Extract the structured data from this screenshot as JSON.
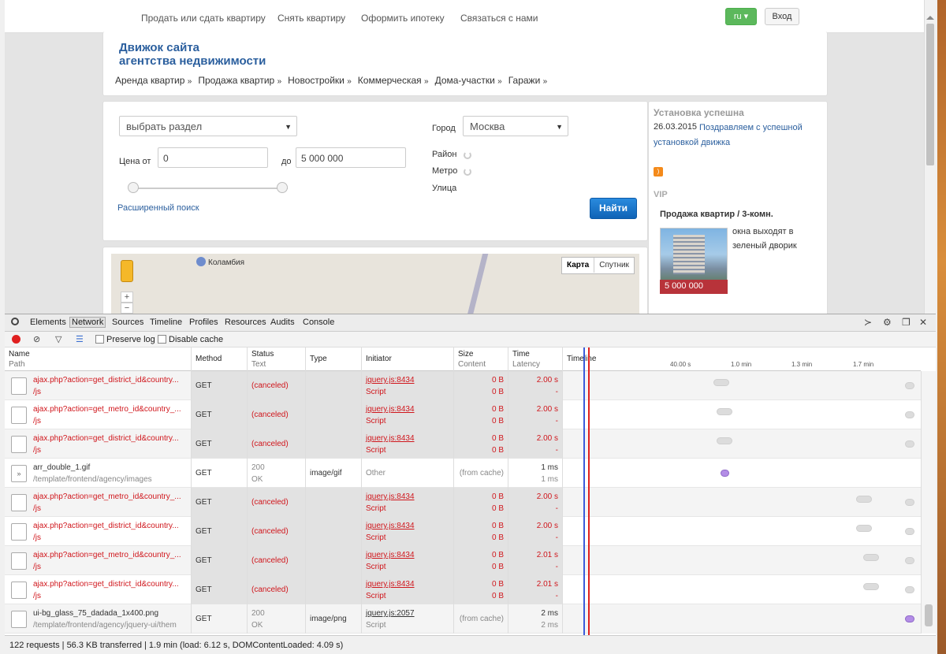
{
  "site": {
    "topnav": [
      "Продать или сдать квартиру",
      "Снять квартиру",
      "Оформить ипотеку",
      "Связаться с нами"
    ],
    "lang": "ru",
    "login": "Вход",
    "title_line1": "Движок сайта",
    "title_line2": "агентства недвижимости",
    "catnav": [
      "Аренда квартир",
      "Продажа квартир",
      "Новостройки",
      "Коммерческая",
      "Дома-участки",
      "Гаражи"
    ],
    "catnav_suffix": "»",
    "search": {
      "section_select": "выбрать раздел",
      "price_from_label": "Цена от",
      "price_from_value": "0",
      "price_to_label": "до",
      "price_to_value": "5 000 000",
      "advanced_link": "Расширенный поиск",
      "city_label": "Город",
      "city_value": "Москва",
      "district_label": "Район",
      "metro_label": "Метро",
      "street_label": "Улица",
      "find_button": "Найти"
    },
    "map": {
      "place": "Коламбия",
      "zoom_in": "+",
      "zoom_out": "−",
      "type_map": "Карта",
      "type_satellite": "Спутник"
    },
    "side": {
      "news_title": "Установка успешна",
      "news_date": "26.03.2015",
      "news_text": "Поздравляем с успешной установкой движка",
      "vip_label": "VIP",
      "vip_title": "Продажа квартир / 3-комн.",
      "vip_desc": "окна выходят в зеленый дворик",
      "vip_price": "5 000 000"
    }
  },
  "devtools": {
    "tabs": [
      "Elements",
      "Network",
      "Sources",
      "Timeline",
      "Profiles",
      "Resources",
      "Audits",
      "Console"
    ],
    "active_tab": "Network",
    "toolbar": {
      "preserve_log": "Preserve log",
      "disable_cache": "Disable cache"
    },
    "columns": {
      "name": "Name",
      "path": "Path",
      "method": "Method",
      "status": "Status",
      "text": "Text",
      "type": "Type",
      "initiator": "Initiator",
      "size": "Size",
      "content": "Content",
      "time": "Time",
      "latency": "Latency",
      "timeline": "Timeline"
    },
    "ticks": [
      "40.00 s",
      "1.0 min",
      "1.3 min",
      "1.7 min"
    ],
    "rows": [
      {
        "name": "ajax.php?action=get_district_id&country...",
        "path": "/js",
        "method": "GET",
        "status": "(canceled)",
        "status2": "",
        "type": "",
        "init": "jquery.js:8434",
        "init2": "Script",
        "size": "0 B",
        "content": "0 B",
        "time": "2.00 s",
        "latency": "-",
        "canceled": true,
        "icon": "doc",
        "bar_at": 0.42
      },
      {
        "name": "ajax.php?action=get_metro_id&country_...",
        "path": "/js",
        "method": "GET",
        "status": "(canceled)",
        "status2": "",
        "type": "",
        "init": "jquery.js:8434",
        "init2": "Script",
        "size": "0 B",
        "content": "0 B",
        "time": "2.00 s",
        "latency": "-",
        "canceled": true,
        "icon": "doc",
        "bar_at": 0.43
      },
      {
        "name": "ajax.php?action=get_district_id&country...",
        "path": "/js",
        "method": "GET",
        "status": "(canceled)",
        "status2": "",
        "type": "",
        "init": "jquery.js:8434",
        "init2": "Script",
        "size": "0 B",
        "content": "0 B",
        "time": "2.00 s",
        "latency": "-",
        "canceled": true,
        "icon": "doc",
        "bar_at": 0.43
      },
      {
        "name": "arr_double_1.gif",
        "path": "/template/frontend/agency/images",
        "method": "GET",
        "status": "200",
        "status2": "OK",
        "type": "image/gif",
        "init": "Other",
        "init2": "",
        "size": "(from cache)",
        "content": "",
        "time": "1 ms",
        "latency": "1 ms",
        "canceled": false,
        "icon": "gif",
        "bar_at": 0.44
      },
      {
        "name": "ajax.php?action=get_metro_id&country_...",
        "path": "/js",
        "method": "GET",
        "status": "(canceled)",
        "status2": "",
        "type": "",
        "init": "jquery.js:8434",
        "init2": "Script",
        "size": "0 B",
        "content": "0 B",
        "time": "2.00 s",
        "latency": "-",
        "canceled": true,
        "icon": "doc",
        "bar_at": 0.82
      },
      {
        "name": "ajax.php?action=get_district_id&country...",
        "path": "/js",
        "method": "GET",
        "status": "(canceled)",
        "status2": "",
        "type": "",
        "init": "jquery.js:8434",
        "init2": "Script",
        "size": "0 B",
        "content": "0 B",
        "time": "2.00 s",
        "latency": "-",
        "canceled": true,
        "icon": "doc",
        "bar_at": 0.82
      },
      {
        "name": "ajax.php?action=get_metro_id&country_...",
        "path": "/js",
        "method": "GET",
        "status": "(canceled)",
        "status2": "",
        "type": "",
        "init": "jquery.js:8434",
        "init2": "Script",
        "size": "0 B",
        "content": "0 B",
        "time": "2.01 s",
        "latency": "-",
        "canceled": true,
        "icon": "doc",
        "bar_at": 0.84
      },
      {
        "name": "ajax.php?action=get_district_id&country...",
        "path": "/js",
        "method": "GET",
        "status": "(canceled)",
        "status2": "",
        "type": "",
        "init": "jquery.js:8434",
        "init2": "Script",
        "size": "0 B",
        "content": "0 B",
        "time": "2.01 s",
        "latency": "-",
        "canceled": true,
        "icon": "doc",
        "bar_at": 0.84
      },
      {
        "name": "ui-bg_glass_75_dadada_1x400.png",
        "path": "/template/frontend/agency/jquery-ui/them",
        "method": "GET",
        "status": "200",
        "status2": "OK",
        "type": "image/png",
        "init": "jquery.js:2057",
        "init2": "Script",
        "size": "(from cache)",
        "content": "",
        "time": "2 ms",
        "latency": "2 ms",
        "canceled": false,
        "icon": "doc",
        "bar_at": null
      }
    ],
    "status_bar": "122 requests | 56.3 KB transferred | 1.9 min (load: 6.12 s, DOMContentLoaded: 4.09 s)",
    "colors": {
      "canceled": "#d0161c",
      "domcontent_line": "#3b5bdb",
      "load_line": "#e02020"
    }
  }
}
